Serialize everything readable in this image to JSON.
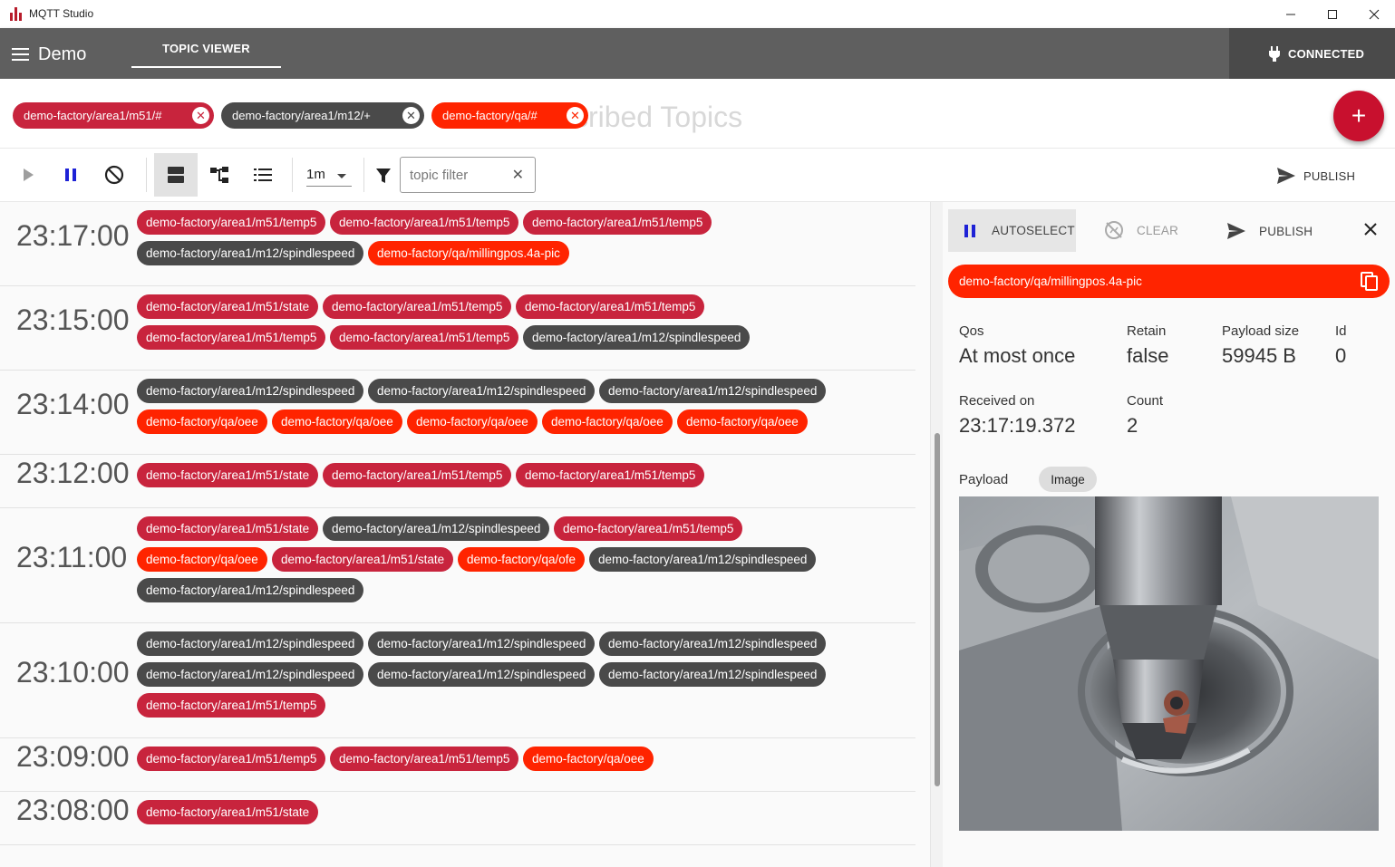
{
  "window": {
    "title": "MQTT Studio",
    "minimize": "—",
    "maximize": "☐",
    "close": "✕"
  },
  "appbar": {
    "app_name": "Demo",
    "tab": "TOPIC VIEWER",
    "status": "CONNECTED"
  },
  "subscriptions": {
    "placeholder": "Subscribed Topics",
    "chips": [
      {
        "label": "demo-factory/area1/m51/#",
        "color": "#c8243d"
      },
      {
        "label": "demo-factory/area1/m12/+",
        "color": "#4a4a4a"
      },
      {
        "label": "demo-factory/qa/#",
        "color": "#ff2400"
      }
    ],
    "add_label": "+"
  },
  "toolbar": {
    "duration": "1m",
    "filter_placeholder": "topic filter",
    "filter_clear": "✕",
    "publish": "PUBLISH"
  },
  "colors": {
    "m51": "#c8243d",
    "m12": "#4a4a4a",
    "qa": "#ff2400"
  },
  "timeline": [
    {
      "time": "23:17:00",
      "lines": [
        [
          "demo-factory/area1/m51/temp5",
          "demo-factory/area1/m51/temp5",
          "demo-factory/area1/m51/temp5"
        ],
        [
          "demo-factory/area1/m12/spindlespeed",
          "demo-factory/qa/millingpos.4a-pic"
        ]
      ]
    },
    {
      "time": "23:15:00",
      "lines": [
        [
          "demo-factory/area1/m51/state",
          "demo-factory/area1/m51/temp5",
          "demo-factory/area1/m51/temp5"
        ],
        [
          "demo-factory/area1/m51/temp5",
          "demo-factory/area1/m51/temp5",
          "demo-factory/area1/m12/spindlespeed"
        ]
      ]
    },
    {
      "time": "23:14:00",
      "lines": [
        [
          "demo-factory/area1/m12/spindlespeed",
          "demo-factory/area1/m12/spindlespeed",
          "demo-factory/area1/m12/spindlespeed"
        ],
        [
          "demo-factory/qa/oee",
          "demo-factory/qa/oee",
          "demo-factory/qa/oee",
          "demo-factory/qa/oee",
          "demo-factory/qa/oee"
        ]
      ]
    },
    {
      "time": "23:12:00",
      "lines": [
        [
          "demo-factory/area1/m51/state",
          "demo-factory/area1/m51/temp5",
          "demo-factory/area1/m51/temp5"
        ]
      ]
    },
    {
      "time": "23:11:00",
      "lines": [
        [
          "demo-factory/area1/m51/state",
          "demo-factory/area1/m12/spindlespeed",
          "demo-factory/area1/m51/temp5"
        ],
        [
          "demo-factory/qa/oee",
          "demo-factory/area1/m51/state",
          "demo-factory/qa/ofe",
          "demo-factory/area1/m12/spindlespeed"
        ],
        [
          "demo-factory/area1/m12/spindlespeed"
        ]
      ]
    },
    {
      "time": "23:10:00",
      "lines": [
        [
          "demo-factory/area1/m12/spindlespeed",
          "demo-factory/area1/m12/spindlespeed",
          "demo-factory/area1/m12/spindlespeed"
        ],
        [
          "demo-factory/area1/m12/spindlespeed",
          "demo-factory/area1/m12/spindlespeed",
          "demo-factory/area1/m12/spindlespeed"
        ],
        [
          "demo-factory/area1/m51/temp5"
        ]
      ]
    },
    {
      "time": "23:09:00",
      "lines": [
        [
          "demo-factory/area1/m51/temp5",
          "demo-factory/area1/m51/temp5",
          "demo-factory/qa/oee"
        ]
      ]
    },
    {
      "time": "23:08:00",
      "lines": [
        [
          "demo-factory/area1/m51/state"
        ]
      ]
    }
  ],
  "detail": {
    "autoselect": "AUTOSELECT",
    "clear": "CLEAR",
    "publish": "PUBLISH",
    "close": "✕",
    "topic": "demo-factory/qa/millingpos.4a-pic",
    "qos_label": "Qos",
    "qos_value": "At most once",
    "retain_label": "Retain",
    "retain_value": "false",
    "size_label": "Payload size",
    "size_value": "59945 B",
    "id_label": "Id",
    "id_value": "0",
    "received_label": "Received on",
    "received_value": "23:17:19.372",
    "count_label": "Count",
    "count_value": "2",
    "payload_label": "Payload",
    "payload_type": "Image"
  }
}
